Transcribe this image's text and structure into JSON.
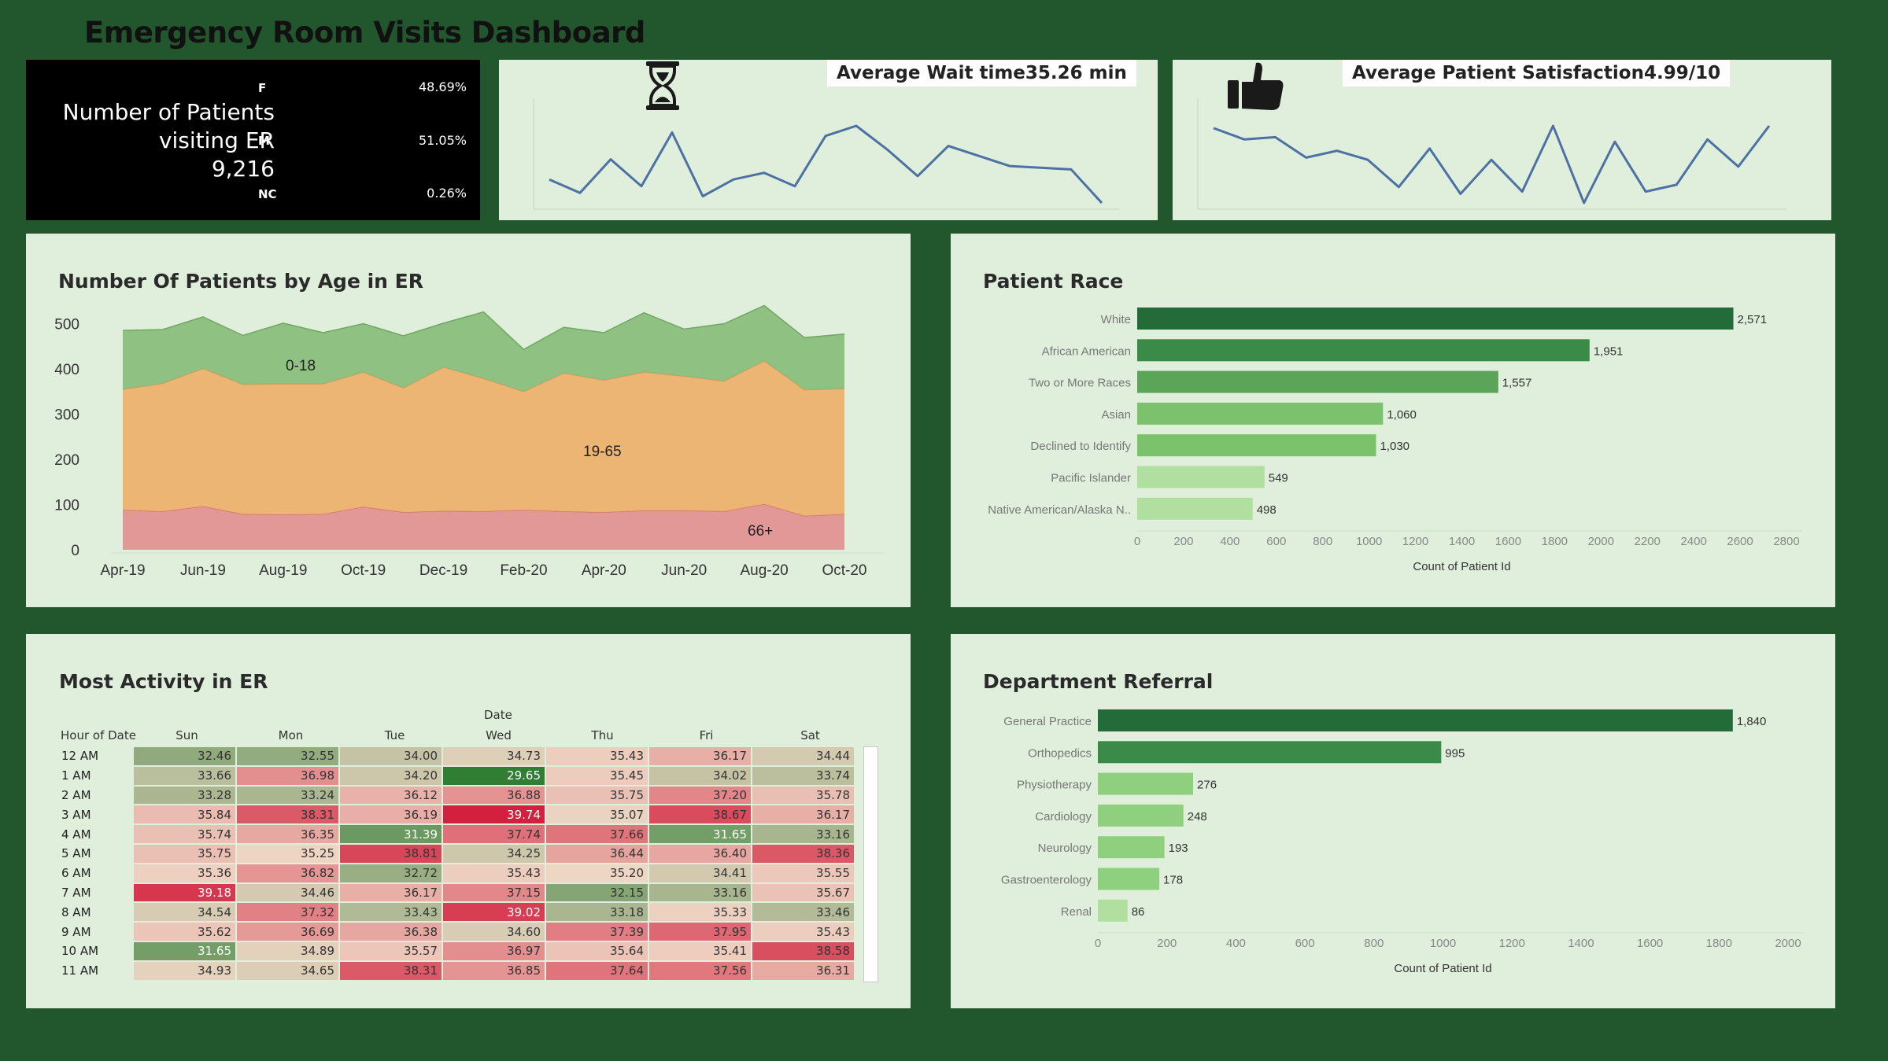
{
  "dashboard": {
    "title": "Emergency Room Visits Dashboard"
  },
  "patients_card": {
    "label_line1": "Number of Patients",
    "label_line2": "visiting ER",
    "count": "9,216",
    "genders": [
      {
        "code": "F",
        "pct": "48.69%"
      },
      {
        "code": "M",
        "pct": "51.05%"
      },
      {
        "code": "NC",
        "pct": "0.26%"
      }
    ]
  },
  "wait_card": {
    "label": "Average Wait time35.26 min",
    "icon": "hourglass-icon",
    "trend": [
      32,
      28,
      38,
      30,
      46,
      27,
      32,
      34,
      30,
      45,
      48,
      41,
      33,
      42,
      39,
      36,
      35.5,
      35,
      25
    ]
  },
  "satisfaction_card": {
    "label": "Average Patient Satisfaction4.99/10",
    "icon": "thumbs-up-icon",
    "trend": [
      6.3,
      5.8,
      5.9,
      5.0,
      5.3,
      4.9,
      3.7,
      5.4,
      3.4,
      4.9,
      3.5,
      6.4,
      3.0,
      5.7,
      3.5,
      3.8,
      5.8,
      4.6,
      6.4
    ]
  },
  "age_chart": {
    "title": "Number Of Patients by Age in ER",
    "area_labels": {
      "young": "0-18",
      "adult": "19-65",
      "senior": "66+"
    }
  },
  "race_chart": {
    "title": "Patient Race",
    "xlabel": "Count of Patient Id",
    "value_labels": [
      "2,571",
      "1,951",
      "1,557",
      "1,060",
      "1,030",
      "549",
      "498"
    ]
  },
  "activity_heatmap": {
    "title": "Most Activity in ER",
    "column_group": "Date",
    "row_header": "Hour of Date",
    "days": [
      "Sun",
      "Mon",
      "Tue",
      "Wed",
      "Thu",
      "Fri",
      "Sat"
    ],
    "hours": [
      "12 AM",
      "1 AM",
      "2 AM",
      "3 AM",
      "4 AM",
      "5 AM",
      "6 AM",
      "7 AM",
      "8 AM",
      "9 AM",
      "10 AM",
      "11 AM"
    ],
    "values": [
      [
        "32.46",
        "32.55",
        "34.00",
        "34.73",
        "35.43",
        "36.17",
        "34.44"
      ],
      [
        "33.66",
        "36.98",
        "34.20",
        "29.65",
        "35.45",
        "34.02",
        "33.74"
      ],
      [
        "33.28",
        "33.24",
        "36.12",
        "36.88",
        "35.75",
        "37.20",
        "35.78"
      ],
      [
        "35.84",
        "38.31",
        "36.19",
        "39.74",
        "35.07",
        "38.67",
        "36.17"
      ],
      [
        "35.74",
        "36.35",
        "31.39",
        "37.74",
        "37.66",
        "31.65",
        "33.16"
      ],
      [
        "35.75",
        "35.25",
        "38.81",
        "34.25",
        "36.44",
        "36.40",
        "38.36"
      ],
      [
        "35.36",
        "36.82",
        "32.72",
        "35.43",
        "35.20",
        "34.41",
        "35.55"
      ],
      [
        "39.18",
        "34.46",
        "36.17",
        "37.15",
        "32.15",
        "33.16",
        "35.67"
      ],
      [
        "34.54",
        "37.32",
        "33.43",
        "39.02",
        "33.18",
        "35.33",
        "33.46"
      ],
      [
        "35.62",
        "36.69",
        "36.38",
        "34.60",
        "37.39",
        "37.95",
        "35.43"
      ],
      [
        "31.65",
        "34.89",
        "35.57",
        "36.97",
        "35.64",
        "35.41",
        "38.58"
      ],
      [
        "34.93",
        "34.65",
        "38.31",
        "36.85",
        "37.64",
        "37.56",
        "36.31"
      ]
    ]
  },
  "referral_chart": {
    "title": "Department Referral",
    "xlabel": "Count of Patient Id",
    "value_labels": [
      "1,840",
      "995",
      "276",
      "248",
      "193",
      "178",
      "86"
    ]
  },
  "colors": {
    "background": "#22562c",
    "panel": "#e0eedc",
    "line": "#4c72a4",
    "bar_dark": "#1e6b3a",
    "bar_light": "#b0dfa0",
    "area_young": "#88bd7a",
    "area_adult": "#edb06a",
    "area_senior": "#e29090"
  },
  "chart_data": [
    {
      "type": "area",
      "title": "Number Of Patients by Age in ER",
      "x": [
        "Apr-19",
        "May-19",
        "Jun-19",
        "Jul-19",
        "Aug-19",
        "Sep-19",
        "Oct-19",
        "Nov-19",
        "Dec-19",
        "Jan-20",
        "Feb-20",
        "Mar-20",
        "Apr-20",
        "May-20",
        "Jun-20",
        "Jul-20",
        "Aug-20",
        "Sep-20",
        "Oct-20"
      ],
      "x_tick_labels": [
        "Apr-19",
        "Jun-19",
        "Aug-19",
        "Oct-19",
        "Dec-19",
        "Feb-20",
        "Apr-20",
        "Jun-20",
        "Aug-20",
        "Oct-20"
      ],
      "stacked": true,
      "series": [
        {
          "name": "66+",
          "values": [
            88,
            85,
            96,
            79,
            78,
            79,
            95,
            83,
            86,
            85,
            88,
            85,
            83,
            87,
            87,
            85,
            101,
            75,
            79
          ]
        },
        {
          "name": "19-65",
          "values": [
            267,
            283,
            305,
            287,
            289,
            288,
            298,
            275,
            318,
            294,
            262,
            306,
            292,
            306,
            297,
            288,
            317,
            279,
            277
          ]
        },
        {
          "name": "0-18",
          "values": [
            130,
            119,
            114,
            108,
            134,
            113,
            107,
            115,
            97,
            147,
            93,
            101,
            105,
            131,
            104,
            127,
            122,
            115,
            121
          ]
        }
      ],
      "yticks": [
        0,
        100,
        200,
        300,
        400,
        500
      ],
      "ylim": [
        0,
        560
      ],
      "grid": false
    },
    {
      "type": "bar",
      "orientation": "horizontal",
      "title": "Patient Race",
      "categories": [
        "White",
        "African American",
        "Two or More Races",
        "Asian",
        "Declined to Identify",
        "Pacific Islander",
        "Native American/Alaska N.."
      ],
      "values": [
        2571,
        1951,
        1557,
        1060,
        1030,
        549,
        498
      ],
      "xlabel": "Count of Patient Id",
      "xticks": [
        0,
        200,
        400,
        600,
        800,
        1000,
        1200,
        1400,
        1600,
        1800,
        2000,
        2200,
        2400,
        2600,
        2800
      ],
      "xlim": [
        0,
        2800
      ]
    },
    {
      "type": "heatmap",
      "title": "Most Activity in ER",
      "x": [
        "Sun",
        "Mon",
        "Tue",
        "Wed",
        "Thu",
        "Fri",
        "Sat"
      ],
      "y": [
        "12 AM",
        "1 AM",
        "2 AM",
        "3 AM",
        "4 AM",
        "5 AM",
        "6 AM",
        "7 AM",
        "8 AM",
        "9 AM",
        "10 AM",
        "11 AM"
      ],
      "color_scale": "green (low) to red (high)"
    },
    {
      "type": "bar",
      "orientation": "horizontal",
      "title": "Department Referral",
      "categories": [
        "General Practice",
        "Orthopedics",
        "Physiotherapy",
        "Cardiology",
        "Neurology",
        "Gastroenterology",
        "Renal"
      ],
      "values": [
        1840,
        995,
        276,
        248,
        193,
        178,
        86
      ],
      "xlabel": "Count of Patient Id",
      "xticks": [
        0,
        200,
        400,
        600,
        800,
        1000,
        1200,
        1400,
        1600,
        1800,
        2000
      ],
      "xlim": [
        0,
        2000
      ]
    }
  ]
}
